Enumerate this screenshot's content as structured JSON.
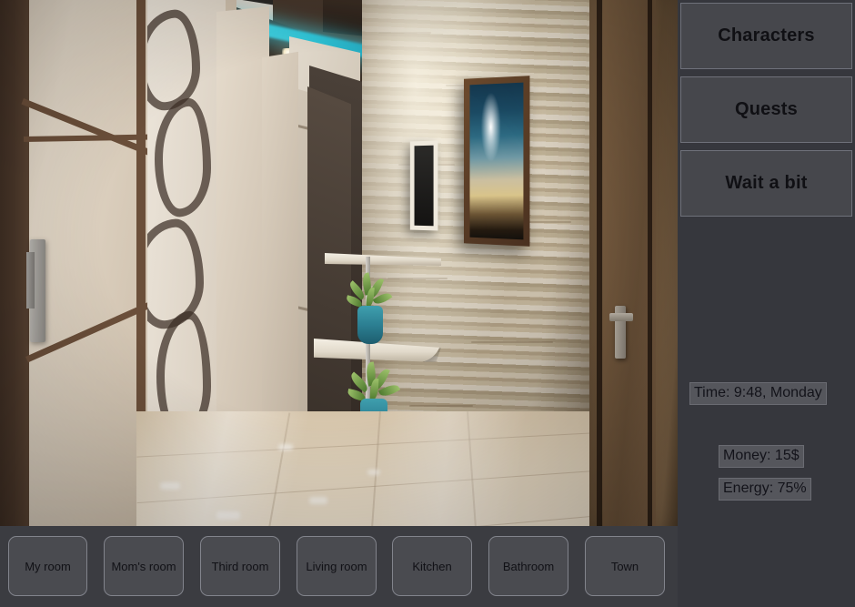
{
  "sidebar": {
    "buttons": [
      {
        "label": "Characters",
        "name": "characters-button"
      },
      {
        "label": "Quests",
        "name": "quests-button"
      },
      {
        "label": "Wait a bit",
        "name": "wait-a-bit-button"
      }
    ],
    "stats": [
      {
        "label": "Time: 9:48, Monday",
        "name": "time-stat"
      },
      {
        "label": "Money: 15$",
        "name": "money-stat"
      },
      {
        "label": "Energy: 75%",
        "name": "energy-stat"
      }
    ],
    "icons": [
      {
        "name": "gear-icon",
        "title": "Settings"
      },
      {
        "name": "save-download-icon",
        "title": "Save"
      },
      {
        "name": "load-upload-icon",
        "title": "Load"
      }
    ]
  },
  "bottom_nav": {
    "buttons": [
      {
        "label": "My room",
        "name": "nav-my-room"
      },
      {
        "label": "Mom's room",
        "name": "nav-moms-room"
      },
      {
        "label": "Third room",
        "name": "nav-third-room"
      },
      {
        "label": "Living room",
        "name": "nav-living-room"
      },
      {
        "label": "Kitchen",
        "name": "nav-kitchen"
      },
      {
        "label": "Bathroom",
        "name": "nav-bathroom"
      },
      {
        "label": "Town",
        "name": "nav-town"
      }
    ]
  },
  "scene": {
    "description": "Rendered interior hallway with stone accent wall, framed abstract painting, floating corner shelves with potted plants, sliding wardrobe doors, teal LED cove lighting, glossy tiled floor and a wooden door on the right",
    "alt_short": "Hallway"
  },
  "colors": {
    "panel_bg": "#36373d",
    "bottom_bar_bg": "#3b3c41",
    "button_bg": "#46474c",
    "button_border": "#6f717a",
    "nav_button_bg": "#4a4b50",
    "nav_button_border": "#82848c",
    "stat_bg": "#55565c",
    "text_dark": "#101014",
    "accent_teal": "#3fd2e4"
  }
}
